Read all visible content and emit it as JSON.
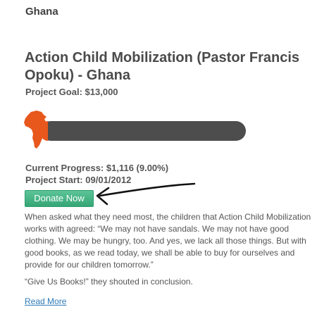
{
  "country": "Ghana",
  "project": {
    "title": "Action Child Mobilization (Pastor Francis Opoku) - Ghana",
    "goal_label": "Project Goal:",
    "goal_value": "$13,000",
    "progress_label": "Current Progress:",
    "progress_value": "$1,116 (9.00%)",
    "progress_fraction": 0.09,
    "start_label": "Project Start:",
    "start_value": "09/01/2012",
    "donate_label": "Donate Now",
    "description": "When asked what they need most, the children that Action Child Mobilization works with agreed: “We may not have sandals. We may not have good clothing. We may be hungry, too. And yes, we lack all those things. But with good books, as we read today, we shall be able to buy for ourselves and provide for our children tomorrow.”",
    "quote": "“Give Us Books!” they shouted in conclusion.",
    "read_more": "Read More"
  },
  "colors": {
    "progress_track": "#4d4d4d",
    "progress_fill": "#e8571c",
    "africa_icon": "#e8571c",
    "donate_bg_top": "#5cc498",
    "donate_bg_bottom": "#36a676",
    "link": "#2e7bb8",
    "arrow": "#111111"
  }
}
